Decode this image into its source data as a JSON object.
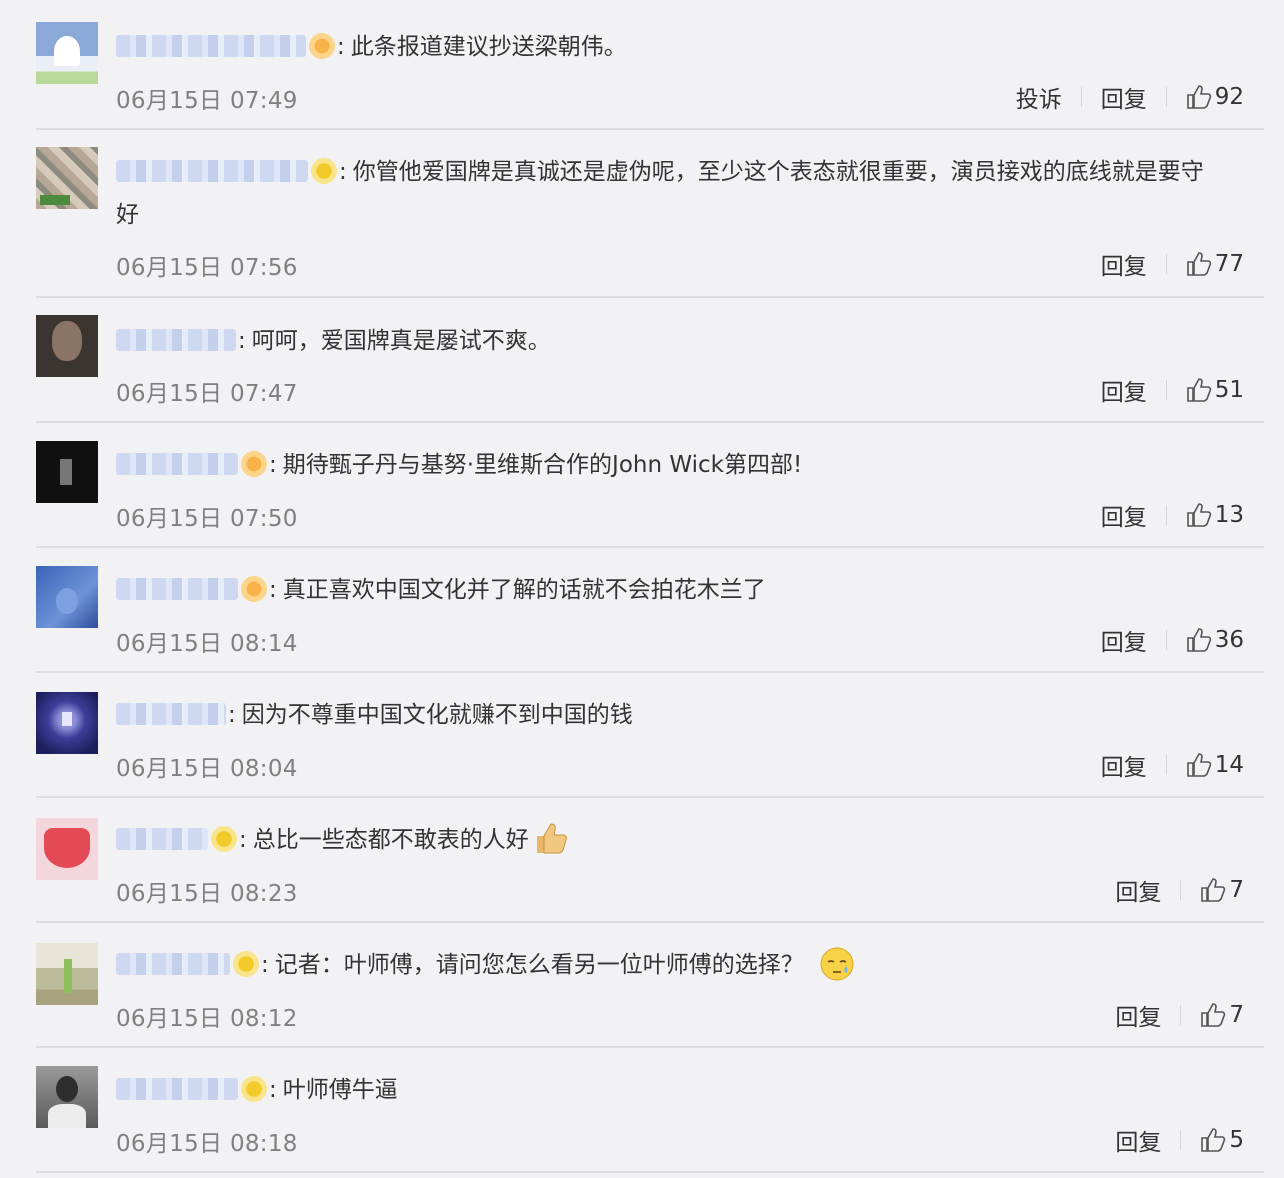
{
  "labels": {
    "report": "投诉",
    "reply": "回复"
  },
  "comments": [
    {
      "text": "此条报道建议抄送梁朝伟。",
      "time": "06月15日 07:49",
      "likes": "92"
    },
    {
      "text": "你管他爱国牌是真诚还是虚伪呢，至少这个表态就很重要，演员接戏的底线就是要守",
      "text2": "好",
      "time": "06月15日 07:56",
      "likes": "77"
    },
    {
      "text": "呵呵，爱国牌真是屡试不爽。",
      "time": "06月15日 07:47",
      "likes": "51"
    },
    {
      "text": "期待甄子丹与基努·里维斯合作的John Wick第四部!",
      "time": "06月15日 07:50",
      "likes": "13"
    },
    {
      "text": "真正喜欢中国文化并了解的话就不会拍花木兰了",
      "time": "06月15日 08:14",
      "likes": "36"
    },
    {
      "text": "因为不尊重中国文化就赚不到中国的钱",
      "time": "06月15日 08:04",
      "likes": "14"
    },
    {
      "text": "总比一些态都不敢表的人好",
      "time": "06月15日 08:23",
      "likes": "7"
    },
    {
      "text": "记者：叶师傅，请问您怎么看另一位叶师傅的选择？",
      "time": "06月15日 08:12",
      "likes": "7"
    },
    {
      "text": "叶师傅牛逼",
      "time": "06月15日 08:18",
      "likes": "5"
    }
  ],
  "icons": {
    "like": "thumbs-up-icon",
    "emoji_thumbs": "thumbs-up-emoji-icon",
    "emoji_sweat": "sweat-face-emoji-icon"
  },
  "colors": {
    "background": "#f2f2f5",
    "timestamp": "#808080",
    "separator": "#dedee2"
  }
}
